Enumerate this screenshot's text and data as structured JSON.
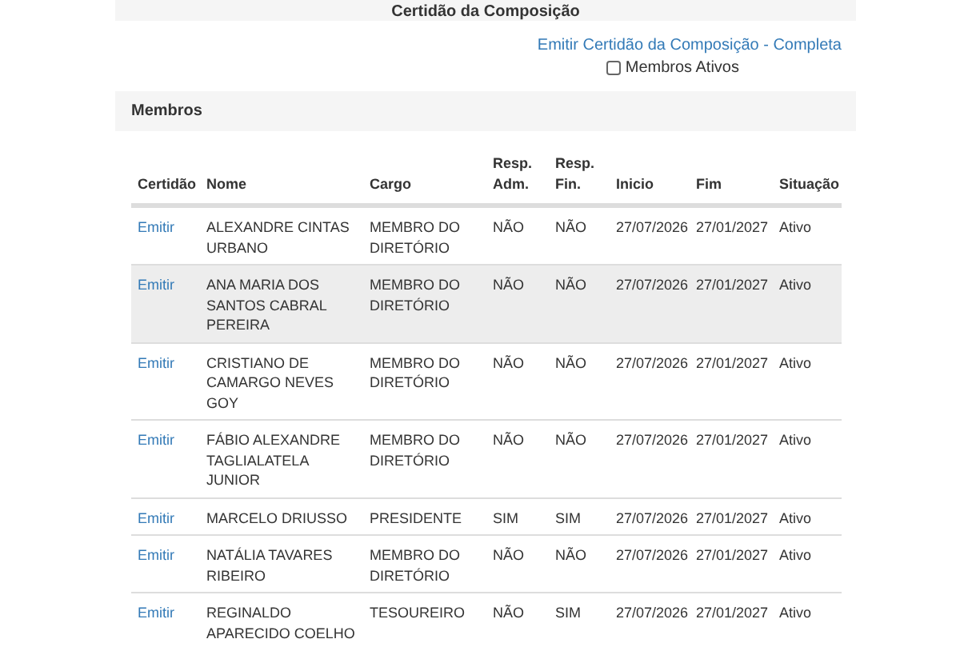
{
  "panel_title": "Certidão da Composição",
  "complete_link": "Emitir Certidão da Composição - Completa",
  "active_filter": {
    "label": "Membros Ativos",
    "checked": false
  },
  "section_title": "Membros",
  "table": {
    "columns": [
      "Certidão",
      "Nome",
      "Cargo",
      "Resp. Adm.",
      "Resp. Fin.",
      "Inicio",
      "Fim",
      "Situação"
    ],
    "rows": [
      {
        "action": "Emitir",
        "name": "ALEXANDRE CINTAS URBANO",
        "role": "MEMBRO DO DIRETÓRIO",
        "adm": "NÃO",
        "fin": "NÃO",
        "start": "27/07/2026",
        "end": "27/01/2027",
        "status": "Ativo",
        "highlighted": false
      },
      {
        "action": "Emitir",
        "name": "ANA MARIA DOS SANTOS CABRAL PEREIRA",
        "role": "MEMBRO DO DIRETÓRIO",
        "adm": "NÃO",
        "fin": "NÃO",
        "start": "27/07/2026",
        "end": "27/01/2027",
        "status": "Ativo",
        "highlighted": true
      },
      {
        "action": "Emitir",
        "name": "CRISTIANO DE CAMARGO NEVES GOY",
        "role": "MEMBRO DO DIRETÓRIO",
        "adm": "NÃO",
        "fin": "NÃO",
        "start": "27/07/2026",
        "end": "27/01/2027",
        "status": "Ativo",
        "highlighted": false
      },
      {
        "action": "Emitir",
        "name": "FÁBIO ALEXANDRE TAGLIALATELA JUNIOR",
        "role": "MEMBRO DO DIRETÓRIO",
        "adm": "NÃO",
        "fin": "NÃO",
        "start": "27/07/2026",
        "end": "27/01/2027",
        "status": "Ativo",
        "highlighted": false
      },
      {
        "action": "Emitir",
        "name": "MARCELO DRIUSSO",
        "role": "PRESIDENTE",
        "adm": "SIM",
        "fin": "SIM",
        "start": "27/07/2026",
        "end": "27/01/2027",
        "status": "Ativo",
        "highlighted": false
      },
      {
        "action": "Emitir",
        "name": "NATÁLIA TAVARES RIBEIRO",
        "role": "MEMBRO DO DIRETÓRIO",
        "adm": "NÃO",
        "fin": "NÃO",
        "start": "27/07/2026",
        "end": "27/01/2027",
        "status": "Ativo",
        "highlighted": false
      },
      {
        "action": "Emitir",
        "name": "REGINALDO APARECIDO COELHO",
        "role": "TESOUREIRO",
        "adm": "NÃO",
        "fin": "SIM",
        "start": "27/07/2026",
        "end": "27/01/2027",
        "status": "Ativo",
        "highlighted": false
      }
    ]
  }
}
